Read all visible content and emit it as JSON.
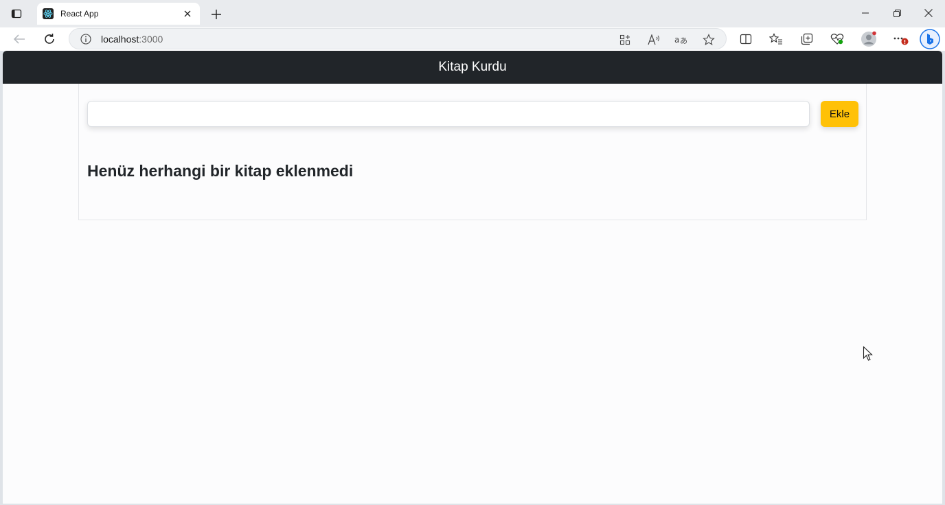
{
  "browser": {
    "tab": {
      "title": "React App"
    },
    "address": {
      "host": "localhost",
      "port": ":3000"
    },
    "colors": {
      "notification_badge": "#c42b1c",
      "profile_dot": "#d13438",
      "copilot": "#1a73e8"
    }
  },
  "app": {
    "navbar": {
      "brand": "Kitap Kurdu",
      "background": "#212529"
    },
    "form": {
      "input_value": "",
      "input_placeholder": "",
      "add_label": "Ekle",
      "add_color": "#ffc107"
    },
    "empty_message": "Henüz herhangi bir kitap eklenmedi"
  }
}
